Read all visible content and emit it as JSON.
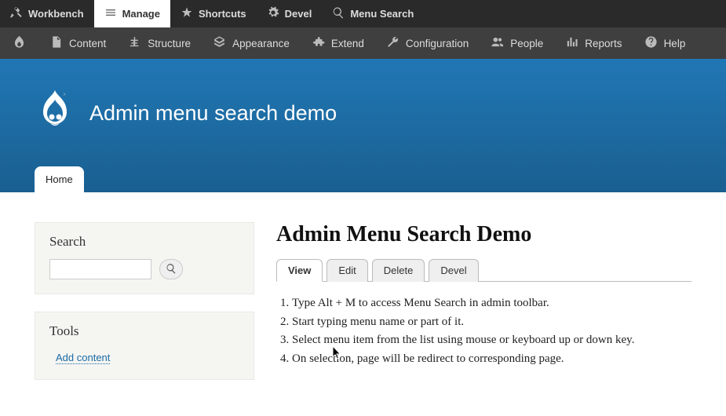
{
  "toolbar_top": {
    "workbench": "Workbench",
    "manage": "Manage",
    "shortcuts": "Shortcuts",
    "devel": "Devel",
    "menu_search": "Menu Search"
  },
  "toolbar_admin": {
    "content": "Content",
    "structure": "Structure",
    "appearance": "Appearance",
    "extend": "Extend",
    "configuration": "Configuration",
    "people": "People",
    "reports": "Reports",
    "help": "Help"
  },
  "site_title": "Admin menu search demo",
  "nav": {
    "home": "Home"
  },
  "sidebar": {
    "search": {
      "title": "Search",
      "value": ""
    },
    "tools": {
      "title": "Tools",
      "add_content": "Add content"
    }
  },
  "content": {
    "title": "Admin Menu Search Demo",
    "tabs": {
      "view": "View",
      "edit": "Edit",
      "delete": "Delete",
      "devel": "Devel"
    },
    "steps": [
      "Type Alt + M to access Menu Search in admin toolbar.",
      "Start typing menu name or part of it.",
      "Select menu item from the list using mouse or keyboard up or down key.",
      "On selection, page will be redirect to corresponding page."
    ]
  }
}
